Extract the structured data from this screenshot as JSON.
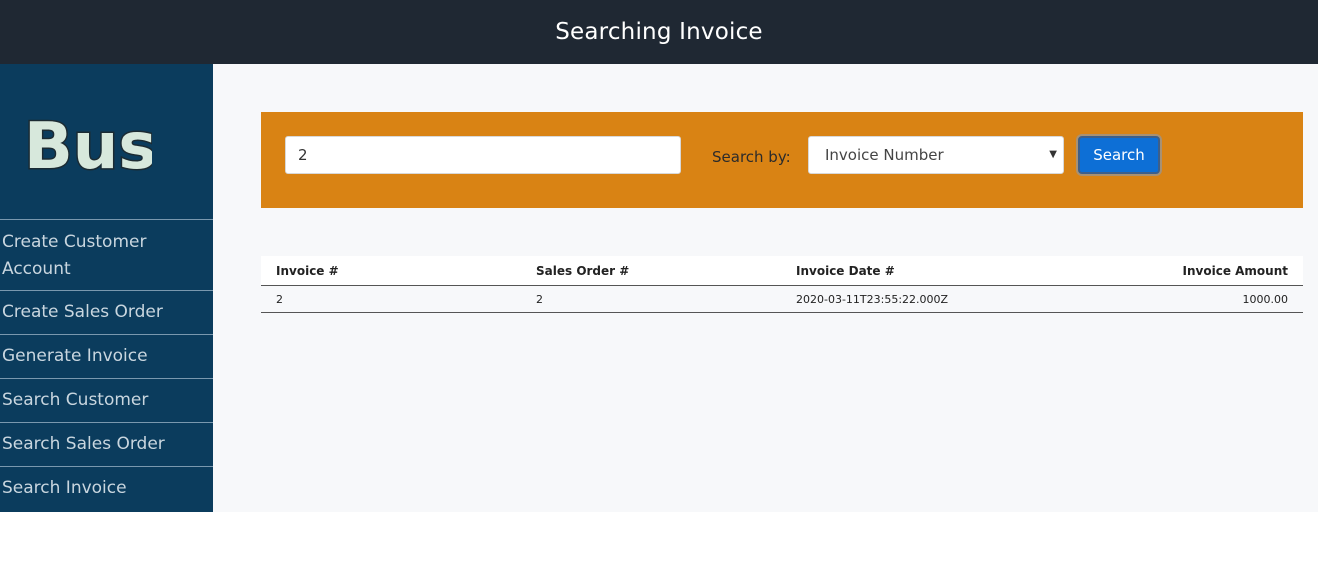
{
  "header": {
    "title": "Searching Invoice"
  },
  "sidebar": {
    "logo_text": "Busi",
    "items": [
      {
        "label": "Create Customer Account"
      },
      {
        "label": "Create Sales Order"
      },
      {
        "label": "Generate Invoice"
      },
      {
        "label": "Search Customer"
      },
      {
        "label": "Search Sales Order"
      },
      {
        "label": "Search Invoice"
      }
    ]
  },
  "search": {
    "query_value": "2",
    "search_by_label": "Search by:",
    "search_by_selected": "Invoice Number",
    "button_label": "Search"
  },
  "table": {
    "columns": [
      "Invoice #",
      "Sales Order #",
      "Invoice Date #",
      "Invoice Amount"
    ],
    "rows": [
      [
        "2",
        "2",
        "2020-03-11T23:55:22.000Z",
        "1000.00"
      ]
    ]
  },
  "colors": {
    "topbar": "#1f2833",
    "sidebar": "#0b3c5d",
    "search_panel": "#d98314",
    "search_button": "#0d6fd6"
  }
}
